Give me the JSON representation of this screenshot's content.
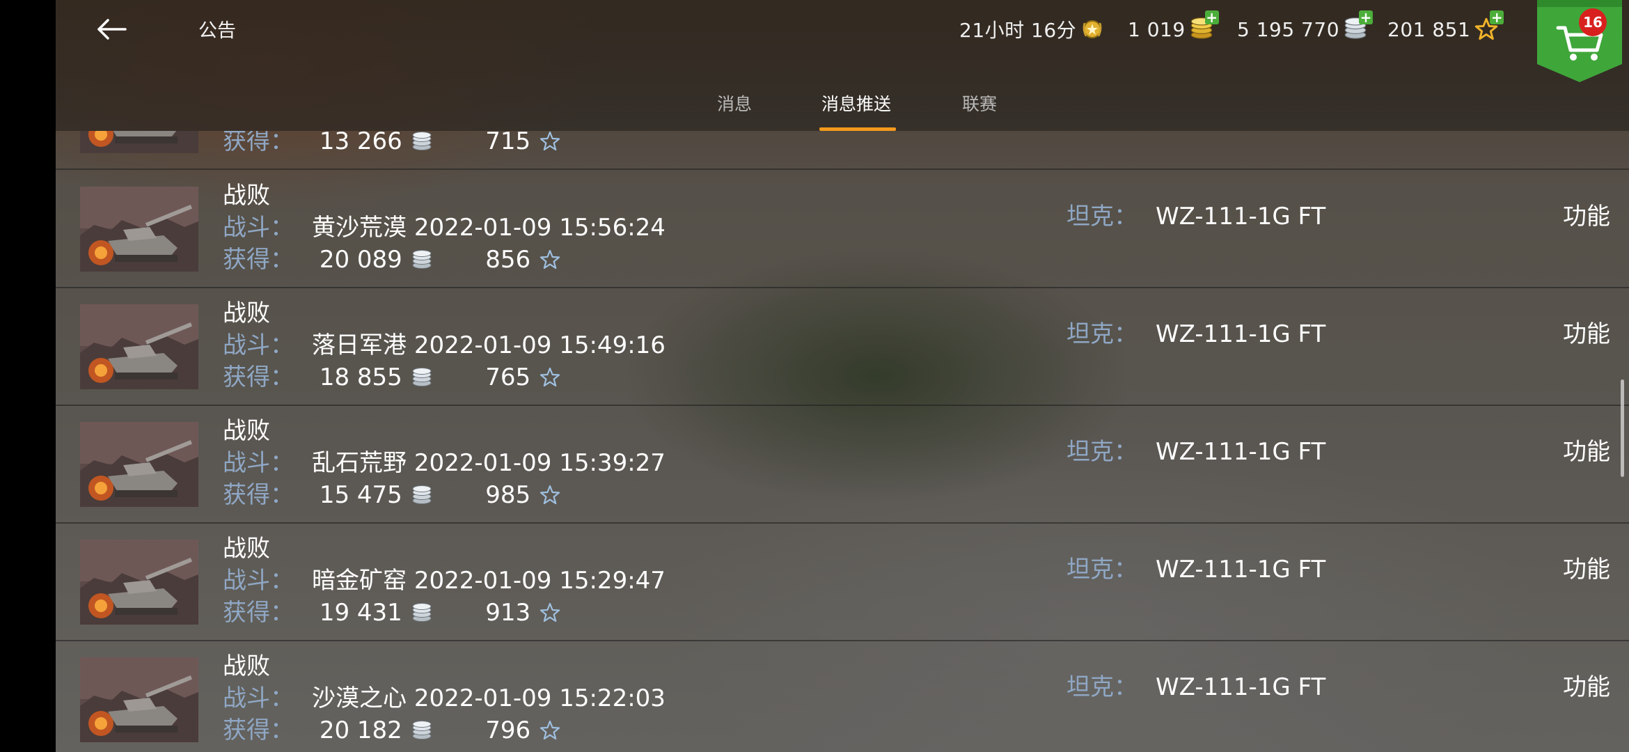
{
  "header": {
    "title": "公告",
    "timer": "21小时 16分",
    "gold": "1 019",
    "credits": "5 195 770",
    "free_xp": "201 851",
    "cart_badge": "16"
  },
  "tabs": [
    {
      "label": "消息",
      "active": false
    },
    {
      "label": "消息推送",
      "active": true
    },
    {
      "label": "联赛",
      "active": false
    }
  ],
  "labels": {
    "battle": "战斗：",
    "earned": "获得：",
    "tank": "坦克：",
    "function": "功能"
  },
  "partial_row": {
    "credits": "13 266",
    "xp": "715"
  },
  "rows": [
    {
      "result": "战败",
      "map": "黄沙荒漠",
      "datetime": "2022-01-09 15:56:24",
      "credits": "20 089",
      "xp": "856",
      "tank": "WZ-111-1G FT"
    },
    {
      "result": "战败",
      "map": "落日军港",
      "datetime": "2022-01-09 15:49:16",
      "credits": "18 855",
      "xp": "765",
      "tank": "WZ-111-1G FT"
    },
    {
      "result": "战败",
      "map": "乱石荒野",
      "datetime": "2022-01-09 15:39:27",
      "credits": "15 475",
      "xp": "985",
      "tank": "WZ-111-1G FT"
    },
    {
      "result": "战败",
      "map": "暗金矿窑",
      "datetime": "2022-01-09 15:29:47",
      "credits": "19 431",
      "xp": "913",
      "tank": "WZ-111-1G FT"
    },
    {
      "result": "战败",
      "map": "沙漠之心",
      "datetime": "2022-01-09 15:22:03",
      "credits": "20 182",
      "xp": "796",
      "tank": "WZ-111-1G FT"
    }
  ],
  "colors": {
    "accent_tab": "#f39a1c",
    "label_blue": "#8fa7c4",
    "cart_green": "#3fa63a",
    "badge_red": "#d8211e"
  }
}
